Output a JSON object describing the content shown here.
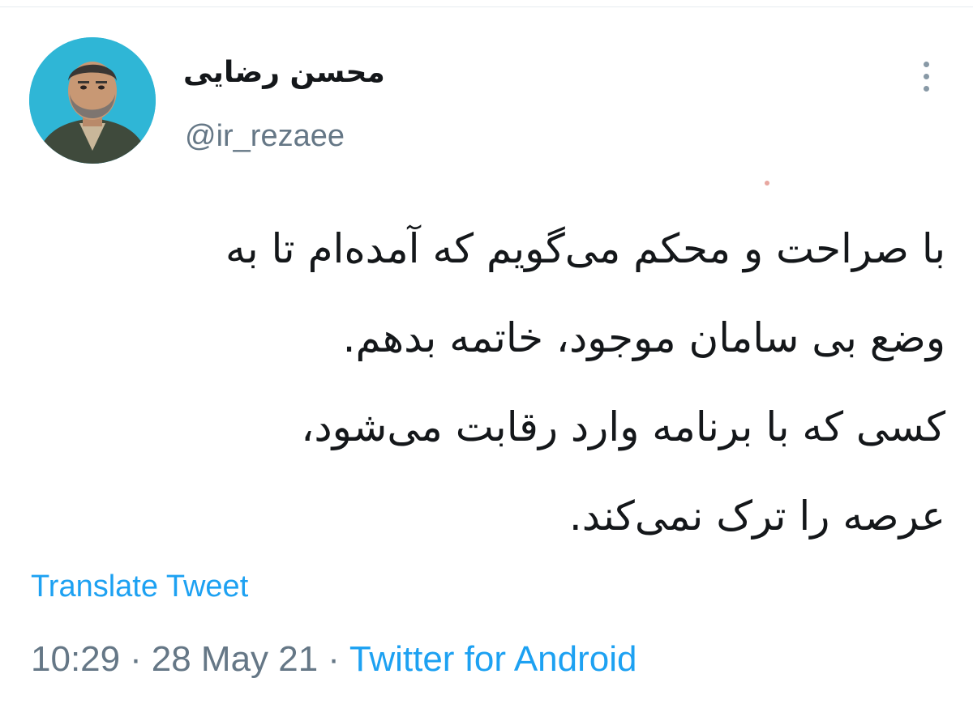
{
  "tweet": {
    "author": {
      "name": "محسن رضایی",
      "handle": "@ir_rezaee",
      "avatar_icon": "profile-photo"
    },
    "menu_icon": "more-vertical-icon",
    "text_lines": [
      "با صراحت و محکم می‌گویم که آمده‌ام تا به",
      "وضع بی سامان موجود، خاتمه بدهم.",
      "کسی که با برنامه وارد رقابت می‌شود،",
      "عرصه را ترک نمی‌کند."
    ],
    "translate_label": "Translate Tweet",
    "time": "10:29",
    "date": "28 May 21",
    "separator": "·",
    "source": "Twitter for Android"
  },
  "colors": {
    "link": "#1da1f2",
    "secondary_text": "#657786",
    "primary_text": "#14171a",
    "avatar_bg": "#2fb6d6"
  }
}
